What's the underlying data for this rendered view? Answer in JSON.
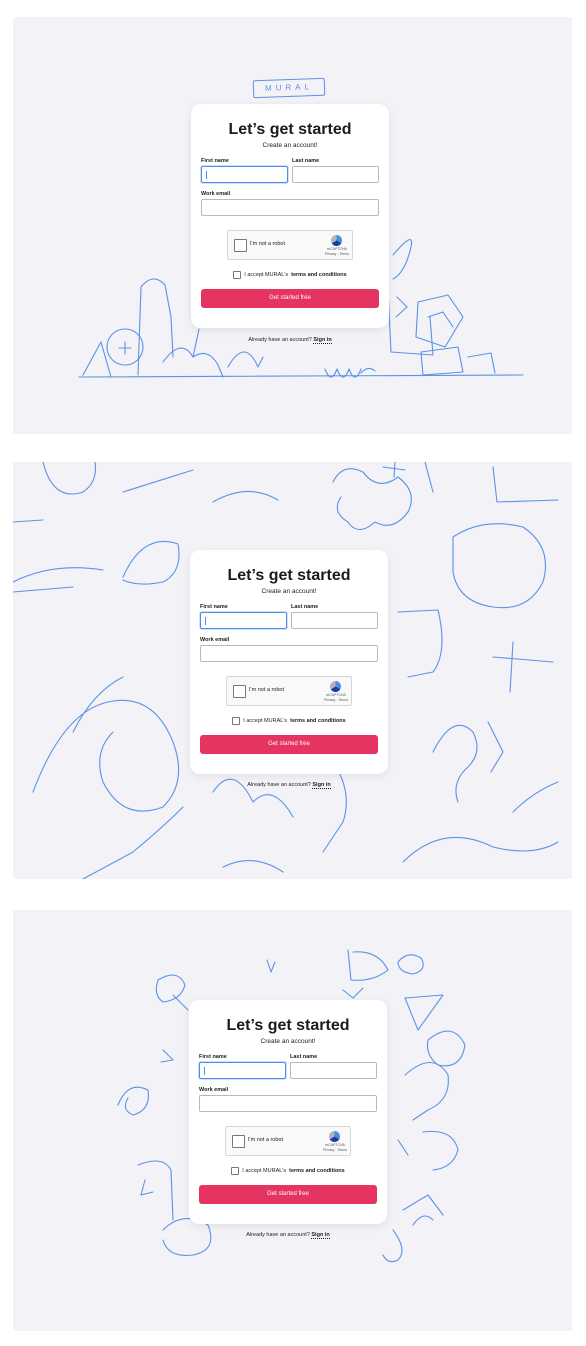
{
  "logo": {
    "text": "MURAL"
  },
  "form": {
    "title": "Let’s get started",
    "subtitle": "Create an account!",
    "first_name_label": "First name",
    "last_name_label": "Last name",
    "work_email_label": "Work email",
    "recaptcha_label": "I'm not a robot",
    "recaptcha_brand": "reCAPTCHA",
    "recaptcha_links": "Privacy - Terms",
    "terms_prefix": "I accept MURAL's",
    "terms_link": "terms and conditions",
    "cta": "Get started free",
    "signin_prefix": "Already have an account?",
    "signin_link": "Sign in"
  },
  "colors": {
    "background": "#f2f2f7",
    "accent": "#e5345f",
    "scribble": "#5b93e6",
    "focus": "#4b8de8"
  }
}
